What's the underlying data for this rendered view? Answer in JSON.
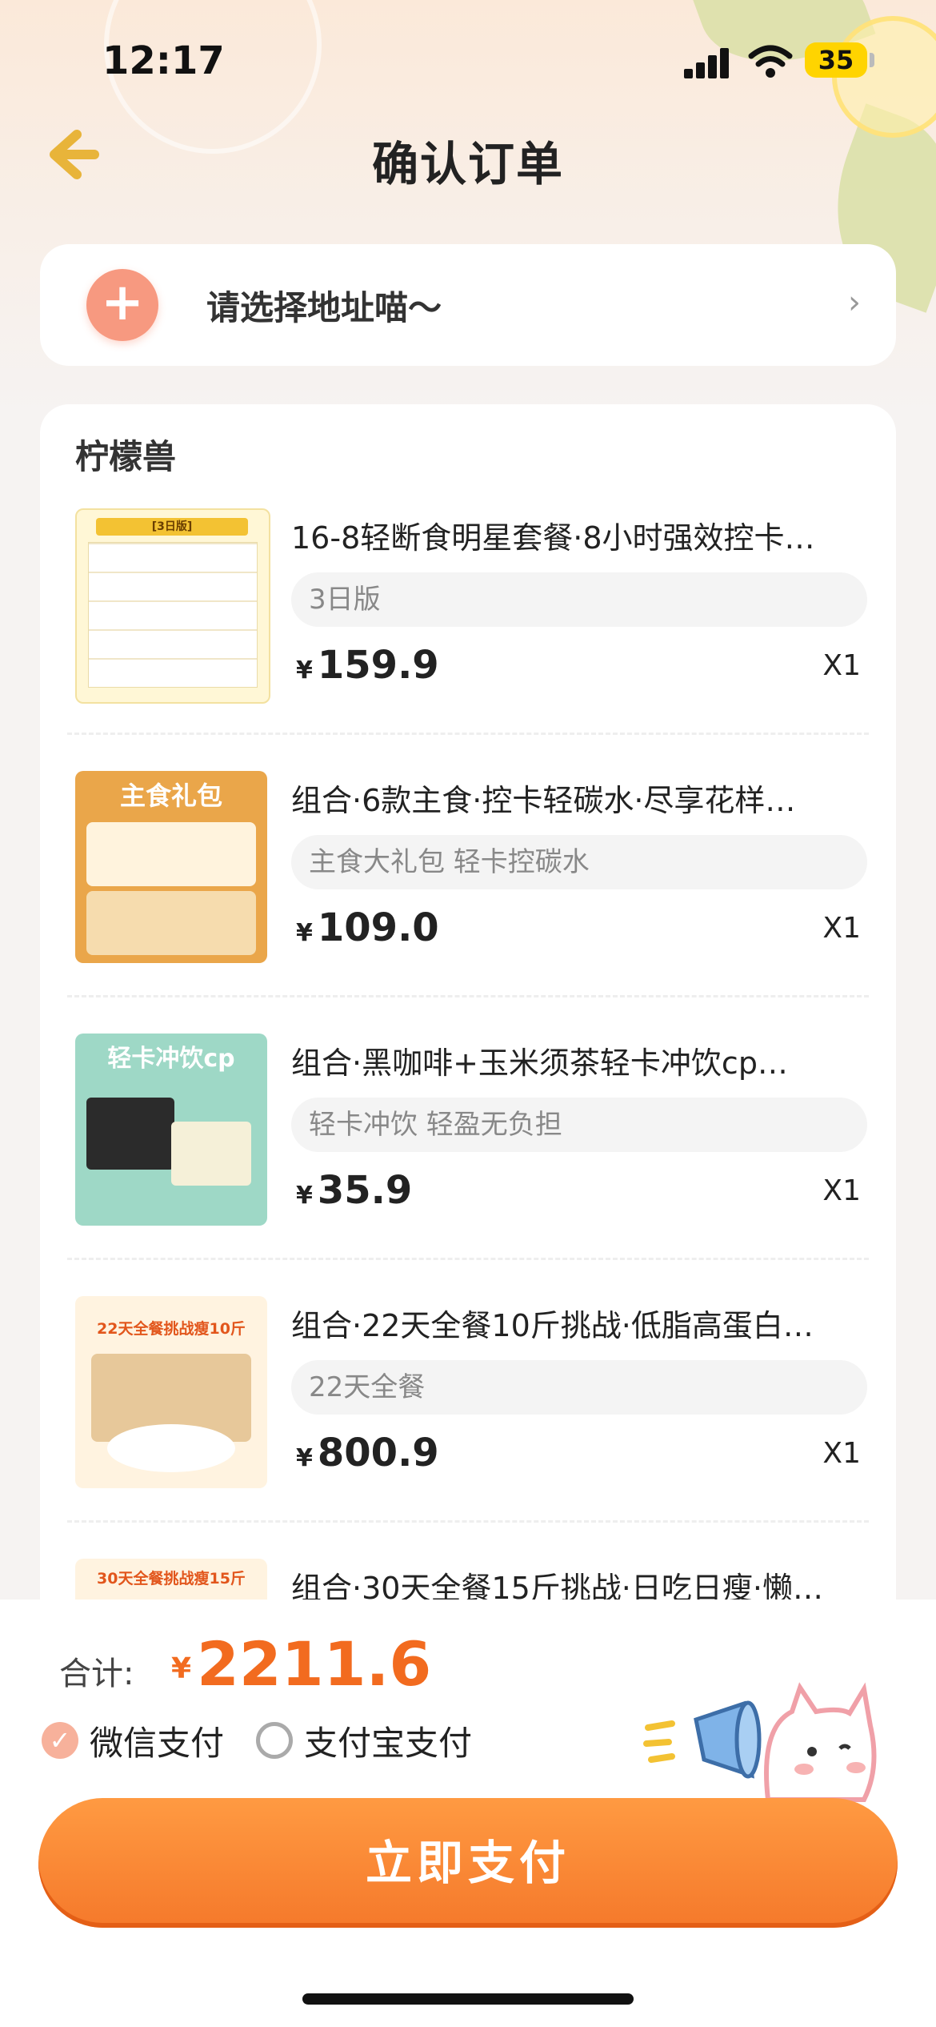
{
  "status_bar": {
    "time": "12:17",
    "battery": "35"
  },
  "header": {
    "title": "确认订单"
  },
  "address": {
    "placeholder": "请选择地址喵～",
    "plus": "+",
    "arrow": "›"
  },
  "shop": {
    "name": "柠檬兽"
  },
  "items": [
    {
      "title": "16-8轻断食明星套餐·8小时强效控卡…",
      "spec": "3日版",
      "yen": "¥",
      "price": "159.9",
      "qty": "X1",
      "image_banner": "[3日版]"
    },
    {
      "title": "组合·6款主食·控卡轻碳水·尽享花样…",
      "spec": "主食大礼包 轻卡控碳水",
      "yen": "¥",
      "price": "109.0",
      "qty": "X1",
      "image_banner": "主食礼包"
    },
    {
      "title": "组合·黑咖啡+玉米须茶轻卡冲饮cp…",
      "spec": "轻卡冲饮 轻盈无负担",
      "yen": "¥",
      "price": "35.9",
      "qty": "X1",
      "image_banner": "轻卡冲饮cp"
    },
    {
      "title": "组合·22天全餐10斤挑战·低脂高蛋白…",
      "spec": "22天全餐",
      "yen": "¥",
      "price": "800.9",
      "qty": "X1",
      "image_banner": "22天全餐挑战瘦10斤"
    },
    {
      "title": "组合·30天全餐15斤挑战·日吃日瘦·懒…",
      "spec": "",
      "yen": "",
      "price": "",
      "qty": "",
      "image_banner": "30天全餐挑战瘦15斤"
    }
  ],
  "footer": {
    "total_label": "合计:",
    "yen": "¥",
    "total": "2211.6",
    "pay_methods": [
      {
        "label": "微信支付",
        "selected": true
      },
      {
        "label": "支付宝支付",
        "selected": false
      }
    ],
    "pay_button": "立即支付"
  },
  "colors": {
    "accent": "#f5792b",
    "price_orange": "#f26b1f",
    "plus_pink": "#f79980"
  }
}
